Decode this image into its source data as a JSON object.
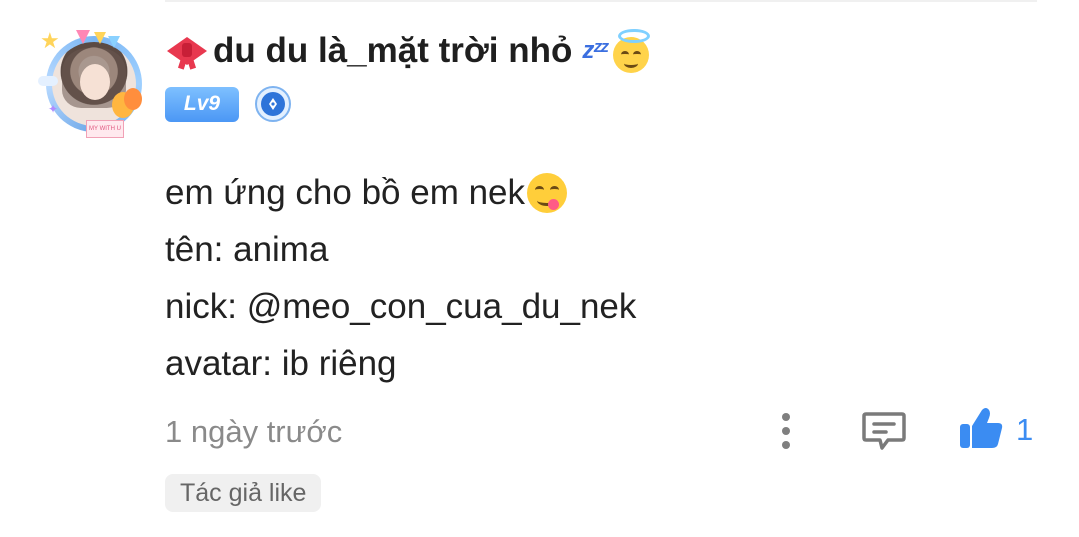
{
  "comment": {
    "author": {
      "name": "du du là_mặt trời nhỏ",
      "level_badge": "Lv9",
      "avatar_frame_text": "MY WITH U"
    },
    "lines": [
      "em ứng cho bồ em nek",
      "tên: anima",
      "nick: @meo_con_cua_du_nek",
      "avatar: ib riêng"
    ],
    "timestamp": "1 ngày trước",
    "like_count": "1",
    "author_like_label": "Tác giả like",
    "icons": [
      "ribbon-bow-icon",
      "sleeping-zzz-icon",
      "angel-halo-emoji-icon",
      "yum-face-emoji-icon",
      "pen-badge-icon",
      "more-vertical-icon",
      "comment-reply-icon",
      "thumbs-up-icon"
    ],
    "colors": {
      "accent_blue": "#3b8cf2",
      "level_badge": "#4b97f5",
      "muted_text": "#8a8a8a"
    }
  }
}
